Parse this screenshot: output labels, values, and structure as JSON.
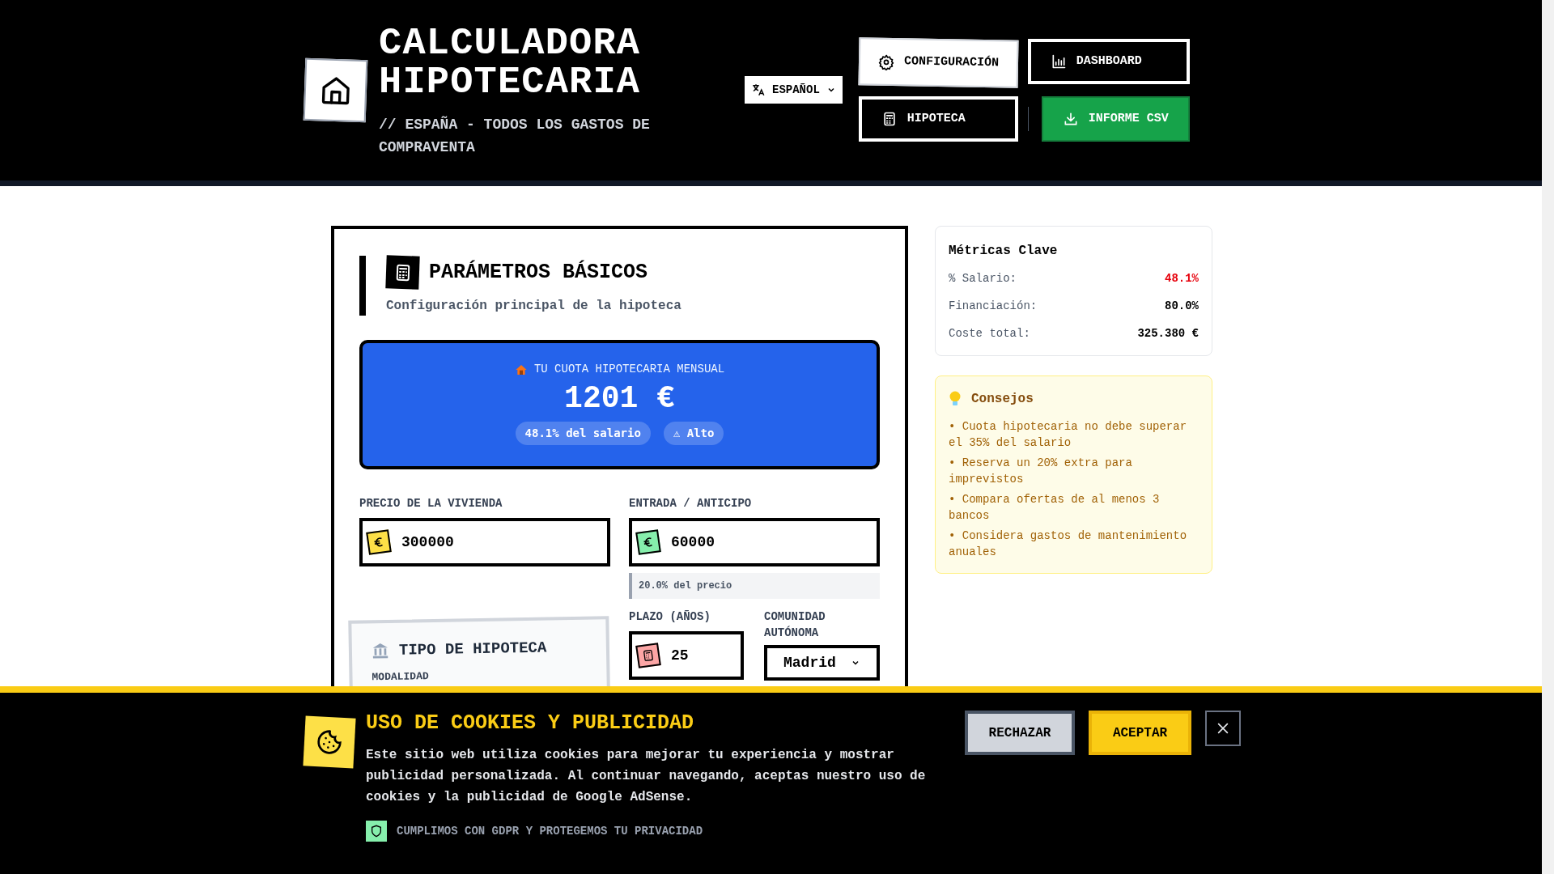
{
  "header": {
    "title_lines": [
      "CALCULADORA",
      "HIPOTECARIA"
    ],
    "subtitle": "// ESPAÑA - TODOS LOS GASTOS DE COMPRAVENTA",
    "language": "ESPAÑOL",
    "nav": [
      {
        "label": "CONFIGURACIÓN",
        "kind": "light"
      },
      {
        "label": "DASHBOARD",
        "kind": "dark"
      },
      {
        "label": "HIPOTECA",
        "kind": "dark"
      },
      {
        "label": "INFORME CSV",
        "kind": "green"
      }
    ]
  },
  "basic": {
    "title": "PARÁMETROS BÁSICOS",
    "subtitle": "Configuración principal de la hipoteca",
    "payment": {
      "label": "TU CUOTA HIPOTECARIA MENSUAL",
      "amount": "1201 €",
      "badges": [
        "48.1% del salario",
        "⚠ Alto"
      ]
    },
    "fields": [
      {
        "label": "PRECIO DE LA VIVIENDA",
        "value": "300000",
        "color": "#fde047"
      },
      {
        "label": "ENTRADA / ANTICIPO",
        "value": "60000",
        "color": "#86efac",
        "hint": "20.0% del precio"
      }
    ],
    "type_card": {
      "title": "TIPO DE HIPOTECA",
      "label": "MODALIDAD"
    },
    "term": {
      "label": "PLAZO (AÑOS)",
      "value": "25",
      "color": "#fca5a5"
    },
    "region": {
      "label": "COMUNIDAD AUTÓNOMA",
      "value": "Madrid"
    }
  },
  "metrics": {
    "title": "Métricas Clave",
    "rows": [
      {
        "label": "% Salario:",
        "value": "48.1%",
        "alert": true
      },
      {
        "label": "Financiación:",
        "value": "80.0%",
        "alert": false
      },
      {
        "label": "Coste total:",
        "value": "325.380 €",
        "alert": false
      }
    ]
  },
  "tips": {
    "title": "Consejos",
    "items": [
      "• Cuota hipotecaria no debe superar el 35% del salario",
      "• Reserva un 20% extra para imprevistos",
      "• Compara ofertas de al menos 3 bancos",
      "• Considera gastos de mantenimiento anuales"
    ]
  },
  "cookies": {
    "title": "USO DE COOKIES Y PUBLICIDAD",
    "text": "Este sitio web utiliza cookies para mejorar tu experiencia y mostrar publicidad personalizada. Al continuar navegando, aceptas nuestro uso de cookies y la publicidad de Google AdSense.",
    "note": "CUMPLIMOS CON GDPR Y PROTEGEMOS TU PRIVACIDAD",
    "buttons": [
      {
        "label": "RECHAZAR",
        "kind": "secondary"
      },
      {
        "label": "ACEPTAR",
        "kind": "primary"
      }
    ]
  }
}
